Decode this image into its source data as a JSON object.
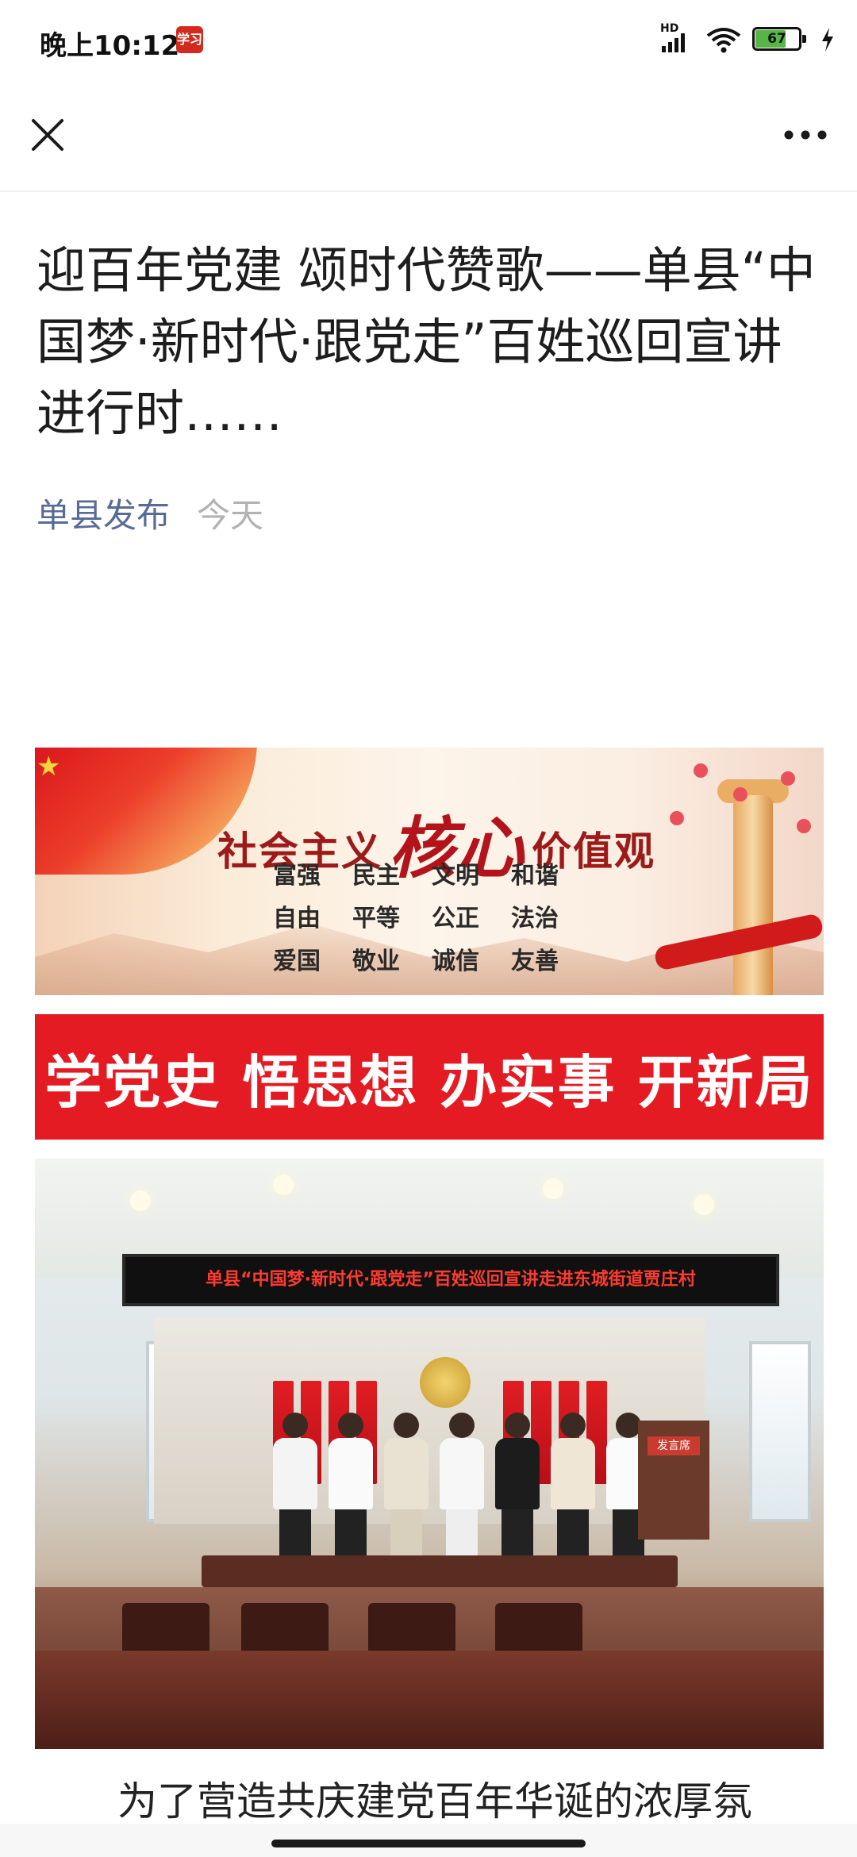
{
  "status_bar": {
    "time": "晚上10:12",
    "app_badge": "学习",
    "network_label": "HD",
    "battery_percent": "67",
    "icons": [
      "signal-icon",
      "wifi-icon",
      "battery-icon",
      "charging-icon"
    ]
  },
  "nav": {
    "close_icon": "close-icon",
    "more_icon": "more-icon"
  },
  "article": {
    "title": "迎百年党建 颂时代赞歌——单县“中国梦·新时代·跟党走”百姓巡回宣讲进行时……",
    "author": "单县发布",
    "date": "今天"
  },
  "values_banner": {
    "title_left": "社会主义",
    "title_core": "核心",
    "title_right": "价值观",
    "values": [
      "富强",
      "民主",
      "文明",
      "和谐",
      "自由",
      "平等",
      "公正",
      "法治",
      "爱国",
      "敬业",
      "诚信",
      "友善"
    ]
  },
  "slogan_banner": {
    "text": "学党史 悟思想 办实事 开新局"
  },
  "photo": {
    "led_sign": "单县“中国梦·新时代·跟党走”百姓巡回宣讲走进东城街道贾庄村",
    "podium_sign": "发言席"
  },
  "body": {
    "first_line": "为了营造共庆建党百年华诞的浓厚氛"
  },
  "colors": {
    "link_blue": "#576b95",
    "meta_gray": "#b2b2b2",
    "banner_red": "#e41b23",
    "battery_green": "#55b545"
  }
}
